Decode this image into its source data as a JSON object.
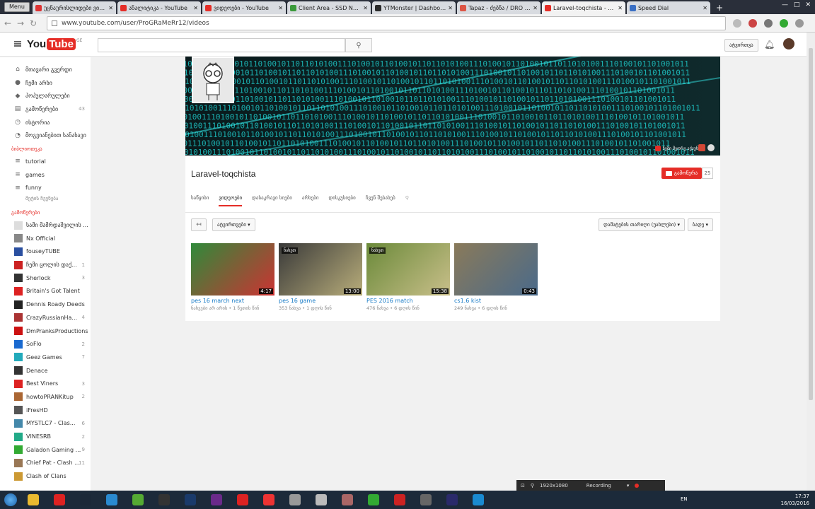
{
  "browser": {
    "menu_label": "Menu",
    "tabs": [
      {
        "title": "უცნაურისლიდები ვიდეოები",
        "color": "#d33"
      },
      {
        "title": "ანალიტიკა - YouTube",
        "color": "#e52d27"
      },
      {
        "title": "ვიდეოები - YouTube",
        "color": "#e52d27"
      },
      {
        "title": "Client Area - SSD Nodes",
        "color": "#3a9a3a"
      },
      {
        "title": "YTMonster | Dashboard",
        "color": "#2a2a2a"
      },
      {
        "title": "Tapaz - ძებნა / DRO [2016]",
        "color": "#d54"
      },
      {
        "title": "Laravel-toqchista - YouTube",
        "color": "#e52d27"
      },
      {
        "title": "Speed Dial",
        "color": "#3a6fc4"
      }
    ],
    "url": "www.youtube.com/user/ProGRaMeRr12/videos"
  },
  "header": {
    "logo_you": "You",
    "logo_tube": "Tube",
    "logo_region": "GE",
    "upload_label": "ატვირთვა"
  },
  "guide": {
    "main_items": [
      {
        "label": "მთავარი გვერდი",
        "icon": "home-icon",
        "glyph": "⌂"
      },
      {
        "label": "ჩემი არხი",
        "icon": "user-icon",
        "glyph": "●"
      },
      {
        "label": "პოპულარულები",
        "icon": "flame-icon",
        "glyph": "◆"
      },
      {
        "label": "გამოწერები",
        "icon": "subscriptions-icon",
        "glyph": "▤",
        "count": "43"
      },
      {
        "label": "ისტორია",
        "icon": "history-icon",
        "glyph": "◷"
      },
      {
        "label": "მოგვიანებით სანახავი",
        "icon": "clock-icon",
        "glyph": "◔"
      }
    ],
    "playlists_title": "ბიბლიოთეკა",
    "playlists": [
      {
        "label": "tutorial"
      },
      {
        "label": "games"
      },
      {
        "label": "funny"
      }
    ],
    "playlists_more": "მეტის ჩვენება",
    "subs_title": "გამოწერები",
    "subscriptions": [
      {
        "label": "სამი მამრდაშვილის ...",
        "color": "#ddd",
        "count": ""
      },
      {
        "label": "Nx Official",
        "color": "#888",
        "count": ""
      },
      {
        "label": "fouseyTUBE",
        "color": "#2a4fa0",
        "count": ""
      },
      {
        "label": "ჩემი ცოლის დაქ...",
        "color": "#c22",
        "count": "1"
      },
      {
        "label": "Sherlock",
        "color": "#333",
        "count": "3"
      },
      {
        "label": "Britain's Got Talent",
        "color": "#d22",
        "count": ""
      },
      {
        "label": "Dennis Roady Deeds",
        "color": "#222",
        "count": ""
      },
      {
        "label": "CrazyRussianHa...",
        "color": "#a33",
        "count": "4"
      },
      {
        "label": "DmPranksProductions",
        "color": "#c11",
        "count": ""
      },
      {
        "label": "SoFlo",
        "color": "#1a6ad0",
        "count": "2"
      },
      {
        "label": "Geez Games",
        "color": "#2ab",
        "count": "7"
      },
      {
        "label": "Denace",
        "color": "#333",
        "count": ""
      },
      {
        "label": "Best Viners",
        "color": "#d22",
        "count": "3"
      },
      {
        "label": "howtoPRANKitup",
        "color": "#a63",
        "count": "2"
      },
      {
        "label": "iFresHD",
        "color": "#555",
        "count": ""
      },
      {
        "label": "MYSTLC7 - Clas...",
        "color": "#48a",
        "count": "6"
      },
      {
        "label": "VINESRB",
        "color": "#2a8",
        "count": "2"
      },
      {
        "label": "Galadon Gaming ...",
        "color": "#3a3",
        "count": "9"
      },
      {
        "label": "Chief Pat - Clash ...",
        "color": "#975",
        "count": "11"
      },
      {
        "label": "Clash of Clans",
        "color": "#c93",
        "count": ""
      }
    ]
  },
  "channel": {
    "title": "Laravel-toqchista",
    "banner_link": "ჩემი მეორე აქაუნტი",
    "subscribe_label": "გამოწერა",
    "subscriber_count": "25",
    "tabs": [
      "საწყისი",
      "ვიდეოები",
      "დასაკრავი სიები",
      "არხები",
      "დისკუსიები",
      "ჩვენ შესახებ"
    ],
    "uploads_label": "ატვირთვები",
    "sort_label": "დამატების თარიღი (უახლესი)",
    "grid_label": "ბადე"
  },
  "videos": [
    {
      "title": "pes 16 march next",
      "views": "ნახვები არ არის",
      "age": "1 წუთის წინ",
      "duration": "4:17",
      "badge": "",
      "colors": [
        "#2f8a3a",
        "#c33"
      ]
    },
    {
      "title": "pes 16 game",
      "views": "353 ნახვა",
      "age": "1 დღის წინ",
      "duration": "13:00",
      "badge": "ნახეთ",
      "colors": [
        "#3a3a3a",
        "#b8ad7a"
      ]
    },
    {
      "title": "PES 2016 match",
      "views": "476 ნახვა",
      "age": "6 დღის წინ",
      "duration": "15:38",
      "badge": "ნახეთ",
      "colors": [
        "#6b8a3a",
        "#c9bf8a"
      ]
    },
    {
      "title": "cs1.6 kist",
      "views": "249 ნახვა",
      "age": "6 დღის წინ",
      "duration": "0:43",
      "badge": "",
      "colors": [
        "#8a7a5a",
        "#4a6a8a"
      ]
    }
  ],
  "recorder": {
    "resolution": "1920x1080",
    "status": "Recording"
  },
  "taskbar": {
    "apps": [
      {
        "name": "chrome-app",
        "color": "#e8b930"
      },
      {
        "name": "opera-app",
        "color": "#d22"
      },
      {
        "name": "steam-app",
        "color": "#1b2838"
      },
      {
        "name": "ccleaner-app",
        "color": "#2a8ad0"
      },
      {
        "name": "camtasia-app",
        "color": "#5a3"
      },
      {
        "name": "obs-app",
        "color": "#333"
      },
      {
        "name": "photoshop-app",
        "color": "#1a3a6a"
      },
      {
        "name": "premiere-app",
        "color": "#6a2a8a"
      },
      {
        "name": "record-app",
        "color": "#d22"
      },
      {
        "name": "rec-app",
        "color": "#e33"
      },
      {
        "name": "notepad-app",
        "color": "#999"
      },
      {
        "name": "explorer-app",
        "color": "#bbb"
      },
      {
        "name": "sublime-app",
        "color": "#a66"
      },
      {
        "name": "cpuz-app",
        "color": "#3a3"
      },
      {
        "name": "filezilla-app",
        "color": "#c22"
      },
      {
        "name": "film-app",
        "color": "#666"
      },
      {
        "name": "aftereffects-app",
        "color": "#2a2a6a"
      },
      {
        "name": "skype-app",
        "color": "#1a8ad0"
      }
    ],
    "app_labels": {
      "steam": "64",
      "ae": "Ae",
      "ps": "Ps"
    },
    "lang": "EN",
    "time": "17:37",
    "date": "16/03/2016"
  }
}
